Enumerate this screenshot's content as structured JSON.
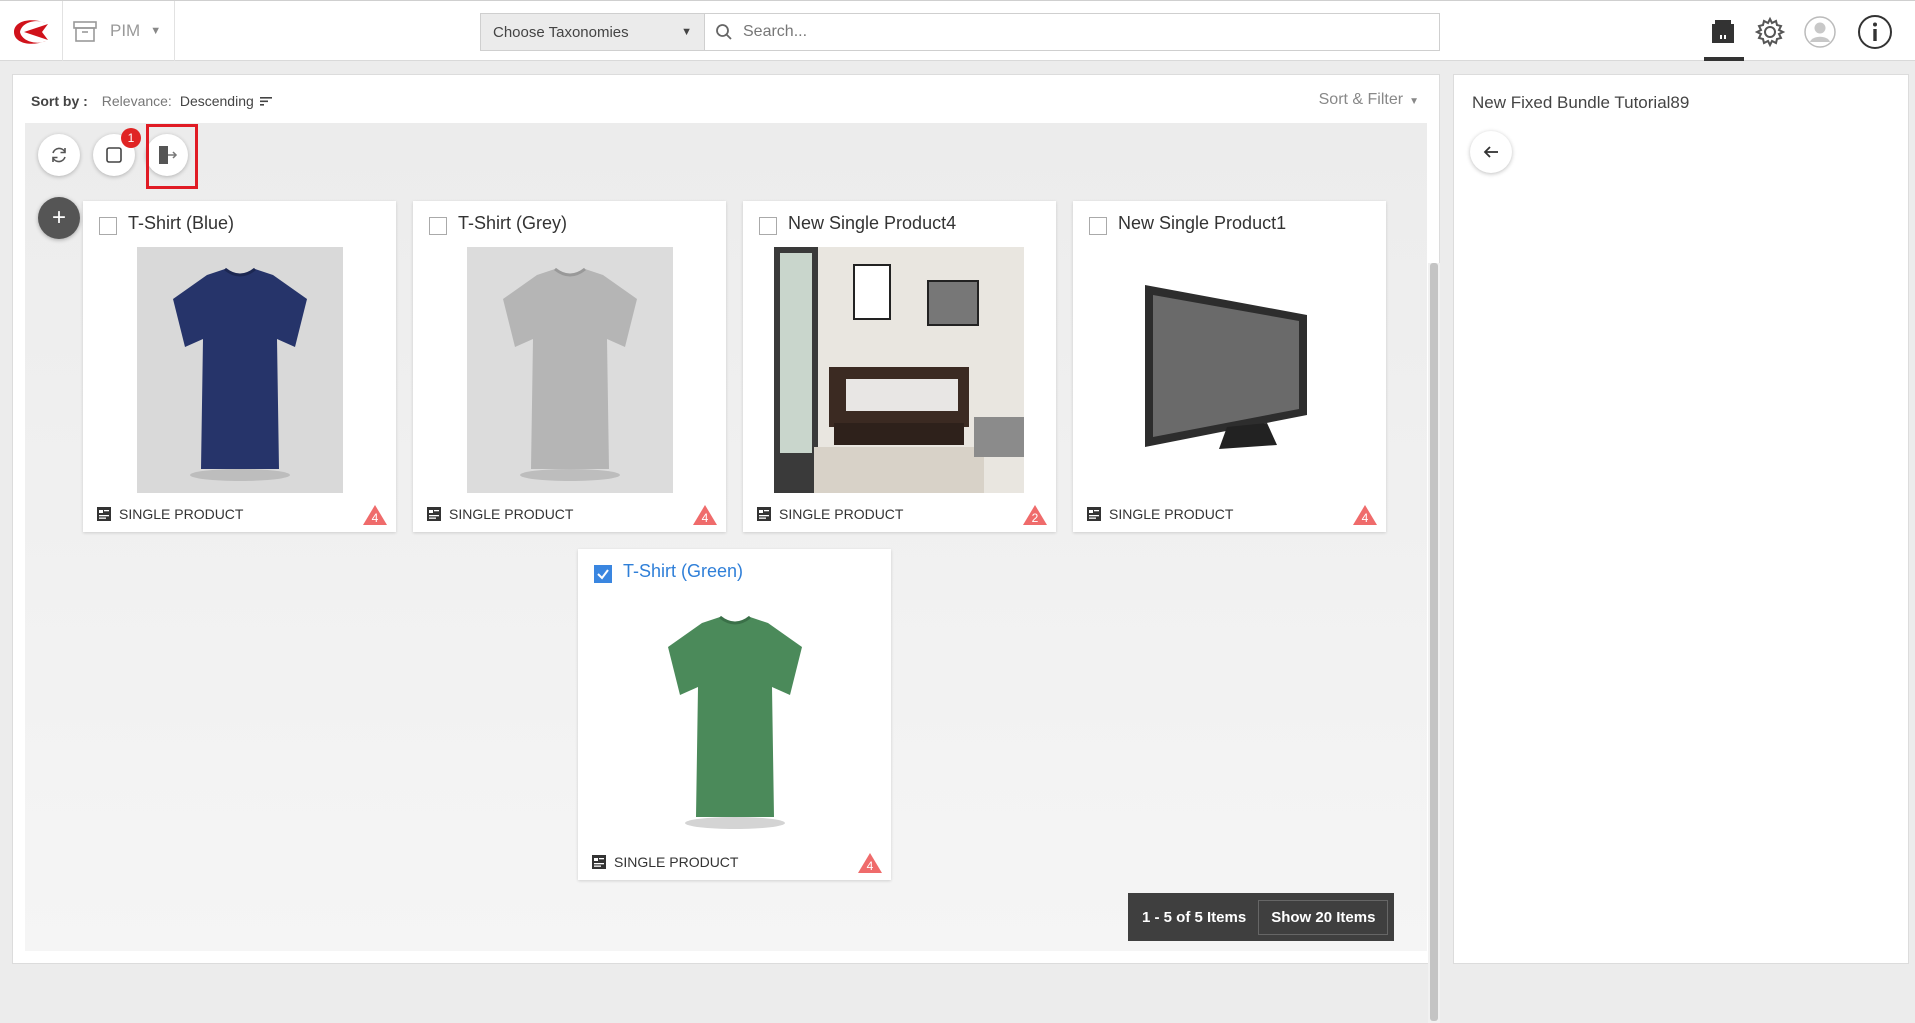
{
  "header": {
    "app_name": "PIM",
    "taxonomy_label": "Choose Taxonomies",
    "search_placeholder": "Search..."
  },
  "sort": {
    "label": "Sort by :",
    "relevance_label": "Relevance:",
    "direction": "Descending",
    "sort_filter_label": "Sort & Filter"
  },
  "toolbar": {
    "selected_count": "1"
  },
  "products": [
    {
      "title": "T-Shirt (Blue)",
      "type": "SINGLE PRODUCT",
      "warnings": "4",
      "checked": false,
      "image": "tshirt-blue"
    },
    {
      "title": "T-Shirt (Grey)",
      "type": "SINGLE PRODUCT",
      "warnings": "4",
      "checked": false,
      "image": "tshirt-grey"
    },
    {
      "title": "New Single Product4",
      "type": "SINGLE PRODUCT",
      "warnings": "2",
      "checked": false,
      "image": "bedroom"
    },
    {
      "title": "New Single Product1",
      "type": "SINGLE PRODUCT",
      "warnings": "4",
      "checked": false,
      "image": "tv"
    },
    {
      "title": "T-Shirt (Green)",
      "type": "SINGLE PRODUCT",
      "warnings": "4",
      "checked": true,
      "image": "tshirt-green"
    }
  ],
  "pagination": {
    "count_text": "1 - 5 of 5 Items",
    "show_text": "Show 20 Items"
  },
  "right_panel": {
    "title": "New Fixed Bundle Tutorial89"
  },
  "colors": {
    "accent": "#2f7fd8",
    "brand_red": "#e01b24",
    "warning": "#ef6b6b"
  }
}
